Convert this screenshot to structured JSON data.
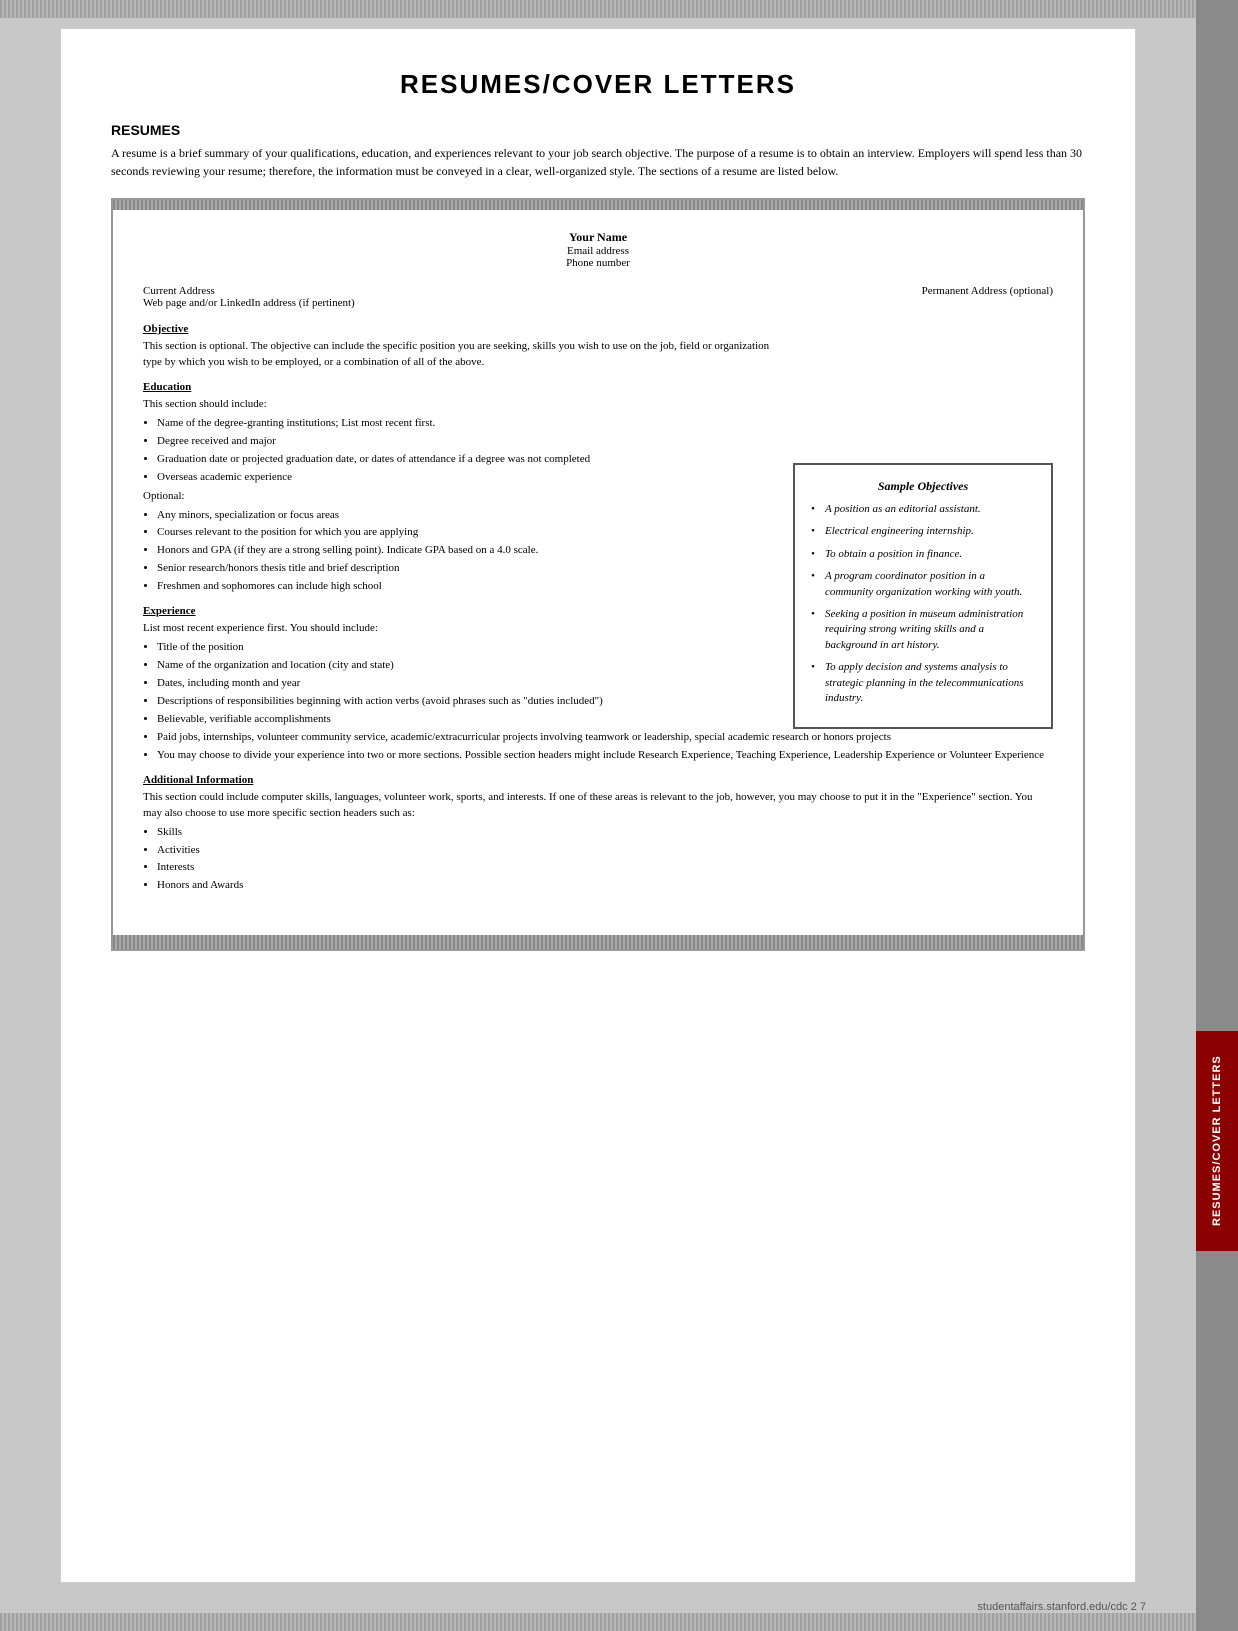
{
  "page": {
    "title": "RESUMES/COVER LETTERS",
    "side_tab_label": "RESUMES/COVER LETTERS",
    "footer": "studentaffairs.stanford.edu/cdc     2  7"
  },
  "resumes_section": {
    "heading": "RESUMES",
    "intro": "A resume is a brief summary of your qualifications, education, and experiences relevant to your job search objective. The purpose of a resume is to obtain an interview. Employers will spend less than 30 seconds reviewing your resume; therefore, the information must be conveyed in a clear, well-organized style. The sections of a resume are listed below."
  },
  "resume_template": {
    "name": "Your Name",
    "email": "Email address",
    "phone": "Phone number",
    "current_address": "Current Address",
    "web": "Web page and/or LinkedIn address (if pertinent)",
    "permanent_address": "Permanent Address (optional)",
    "sections": {
      "objective": {
        "title": "Objective",
        "text": "This section is optional. The objective can include the specific position you are seeking, skills you wish to use on the job, field or organization type by which you wish to be employed, or a combination of all of the above."
      },
      "education": {
        "title": "Education",
        "intro": "This section should include:",
        "bullets": [
          "Name of the degree-granting institutions; List most recent first.",
          "Degree received and major",
          "Graduation date or projected graduation date, or dates of attendance if a degree was not completed",
          "Overseas academic experience"
        ],
        "optional_label": "Optional:",
        "optional_bullets": [
          "Any minors, specialization or focus areas",
          "Courses relevant to the position for which you are applying",
          "Honors and GPA (if they are a strong selling point). Indicate GPA based on a 4.0 scale.",
          "Senior research/honors thesis title and brief description",
          "Freshmen and sophomores can include high school"
        ]
      },
      "experience": {
        "title": "Experience",
        "intro": "List most recent experience first. You should include:",
        "bullets": [
          "Title of the position",
          "Name of the organization and location (city and state)",
          "Dates, including month and year",
          "Descriptions of responsibilities beginning with action verbs (avoid phrases such as \"duties included\")",
          "Believable, verifiable accomplishments",
          "Paid jobs, internships, volunteer community service, academic/extracurricular projects involving teamwork or leadership, special academic research or honors projects",
          "You may choose to divide your experience into two or more sections. Possible section headers might include Research Experience, Teaching Experience, Leadership Experience or Volunteer Experience"
        ]
      },
      "additional_info": {
        "title": "Additional Information",
        "text": "This section could include computer skills, languages, volunteer work, sports, and interests. If one of these areas is relevant to the job, however, you may choose to put it in the \"Experience\" section. You may also choose to use more specific section headers such as:",
        "bullets": [
          "Skills",
          "Activities",
          "Interests",
          "Honors and Awards"
        ]
      }
    }
  },
  "sample_objectives": {
    "title": "Sample Objectives",
    "items": [
      "A position as an editorial assistant.",
      "Electrical engineering internship.",
      "To obtain a position in finance.",
      "A program coordinator position in a community organization working with youth.",
      "Seeking a position in museum administration requiring strong writing skills and a background in art history.",
      "To apply decision and systems analysis to strategic planning in the telecommunications industry."
    ]
  }
}
